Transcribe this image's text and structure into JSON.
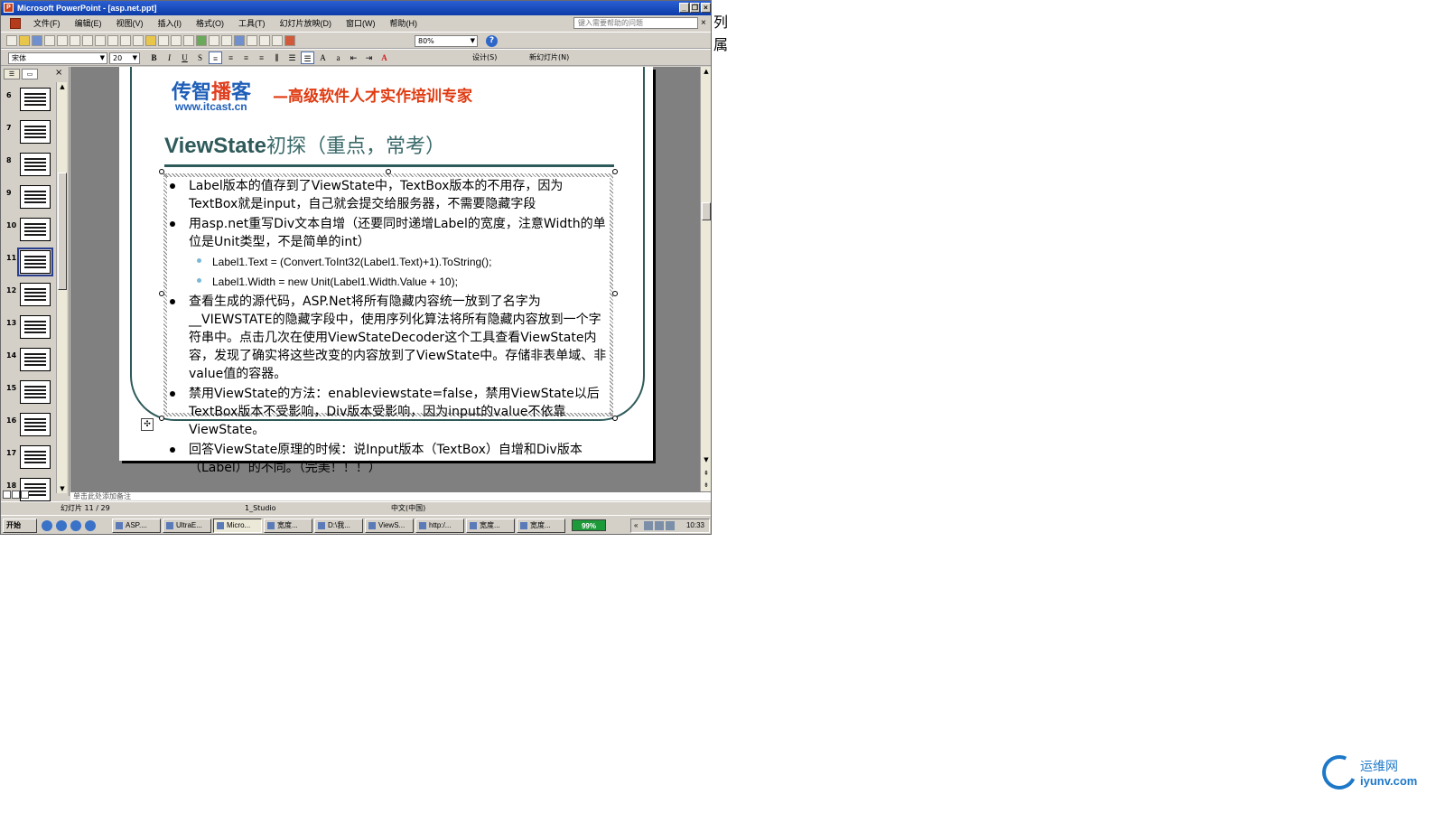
{
  "window": {
    "title": "Microsoft PowerPoint - [asp.net.ppt]",
    "min": "_",
    "restore": "❐",
    "close": "×"
  },
  "menubar": {
    "items": [
      "文件(F)",
      "编辑(E)",
      "视图(V)",
      "插入(I)",
      "格式(O)",
      "工具(T)",
      "幻灯片放映(D)",
      "窗口(W)",
      "帮助(H)"
    ],
    "help_placeholder": "键入需要帮助的问题",
    "help_close": "×"
  },
  "toolbar": {
    "zoom": "80%",
    "help": "?"
  },
  "format_toolbar": {
    "font": "宋体",
    "size": "20",
    "bold": "B",
    "italic": "I",
    "underline": "U",
    "shadow": "S",
    "design": "设计(S)",
    "new_slide": "新幻灯片(N)"
  },
  "thumbnails": {
    "tabs": [
      "☰",
      "▭"
    ],
    "close": "×",
    "items": [
      {
        "num": "6"
      },
      {
        "num": "7"
      },
      {
        "num": "8"
      },
      {
        "num": "9"
      },
      {
        "num": "10"
      },
      {
        "num": "11"
      },
      {
        "num": "12"
      },
      {
        "num": "13"
      },
      {
        "num": "14"
      },
      {
        "num": "15"
      },
      {
        "num": "16"
      },
      {
        "num": "17"
      },
      {
        "num": "18"
      }
    ],
    "selected": "11"
  },
  "slide": {
    "logo_cn_1": "传智",
    "logo_cn_2": "播",
    "logo_cn_3": "客",
    "logo_url": "www.itcast.cn",
    "slogan": "—高级软件人才实作培训专家",
    "title_en": "ViewState",
    "title_cn": "初探（重点，常考）",
    "bullets": [
      {
        "type": "main",
        "text": "Label版本的值存到了ViewState中，TextBox版本的不用存，因为TextBox就是input，自己就会提交给服务器，不需要隐藏字段"
      },
      {
        "type": "main",
        "text": "用asp.net重写Div文本自增（还要同时递增Label的宽度，注意Width的单位是Unit类型，不是简单的int）"
      },
      {
        "type": "code",
        "text": "Label1.Text = (Convert.ToInt32(Label1.Text)+1).ToString();"
      },
      {
        "type": "code",
        "text": "Label1.Width = new Unit(Label1.Width.Value + 10);"
      },
      {
        "type": "main",
        "text": "查看生成的源代码，ASP.Net将所有隐藏内容统一放到了名字为__VIEWSTATE的隐藏字段中，使用序列化算法将所有隐藏内容放到一个字符串中。点击几次在使用ViewStateDecoder这个工具查看ViewState内容，发现了确实将这些改变的内容放到了ViewState中。存储非表单域、非value值的容器。"
      },
      {
        "type": "main",
        "text": "禁用ViewState的方法：enableviewstate=false，禁用ViewState以后TextBox版本不受影响，Div版本受影响，因为input的value不依靠ViewState。"
      },
      {
        "type": "main",
        "text": "回答ViewState原理的时候：说Input版本（TextBox）自增和Div版本（Label）的不同。（完美！！！）"
      }
    ]
  },
  "notes": {
    "placeholder": "单击此处添加备注"
  },
  "status": {
    "slide": "幻灯片 11 / 29",
    "design": "1_Studio",
    "language": "中文(中国)"
  },
  "taskbar": {
    "start": "开始",
    "tasks": [
      "ASP....",
      "UltraE...",
      "Micro...",
      "宽度...",
      "D:\\我...",
      "ViewS...",
      "http:/...",
      "宽度...",
      "宽度..."
    ],
    "active_index": 2,
    "battery": "99%",
    "chevron": "«",
    "clock": "10:33"
  },
  "side_chars": [
    "列",
    "属"
  ],
  "watermark": {
    "top": "运维网",
    "bottom": "iyunv.com"
  },
  "colors": {
    "title_bar": "#0c3ca8",
    "slide_title": "#2f5a5a",
    "slogan": "#e03a10",
    "logo_blue": "#1f5fb8"
  }
}
